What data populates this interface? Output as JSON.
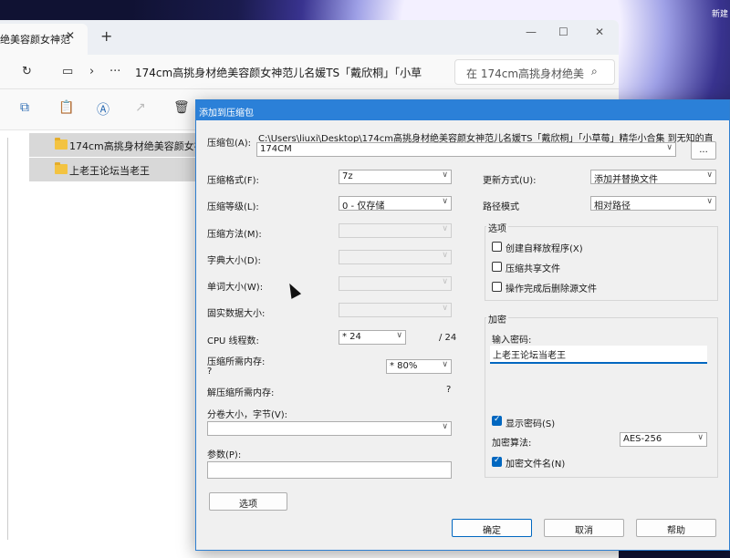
{
  "wallpaper_text": "新建",
  "explorer": {
    "tab_title": "绝美容颜女神范",
    "address_path": "174cm高挑身材绝美容颜女神范儿名媛TS「戴欣桐」「小草",
    "search_placeholder": "在 174cm高挑身材绝美",
    "files": [
      {
        "name": "174cm高挑身材绝美容颜女神范"
      },
      {
        "name": "上老王论坛当老王"
      }
    ]
  },
  "dialog": {
    "title": "添加到压缩包",
    "archive_label": "压缩包(A):",
    "archive_dir": "C:\\Users\\liuxi\\Desktop\\174cm高挑身材绝美容颜女神范儿名媛TS「戴欣桐」「小草莓」精华小合集 到无知的直",
    "archive_name": "174CM",
    "browse_label": "...",
    "format_label": "压缩格式(F):",
    "format_value": "7z",
    "level_label": "压缩等级(L):",
    "level_value": "0 - 仅存储",
    "method_label": "压缩方法(M):",
    "dict_label": "字典大小(D):",
    "word_label": "单词大小(W):",
    "solid_label": "固实数据大小:",
    "cpu_label": "CPU 线程数:",
    "cpu_value": "* 24",
    "cpu_total": "/ 24",
    "mem_label": "压缩所需内存:",
    "mem_q": "?",
    "mem_value": "* 80%",
    "decomp_label": "解压缩所需内存:",
    "decomp_q": "?",
    "split_label": "分卷大小，字节(V):",
    "params_label": "参数(P):",
    "options_button": "选项",
    "update_label": "更新方式(U):",
    "update_value": "添加并替换文件",
    "path_label": "路径模式",
    "path_value": "相对路径",
    "options_group": "选项",
    "opt_sfx": "创建自释放程序(X)",
    "opt_shared": "压缩共享文件",
    "opt_delete": "操作完成后删除源文件",
    "encrypt_group": "加密",
    "pwd_label": "输入密码:",
    "pwd_value": "上老王论坛当老王",
    "show_pwd": "显示密码(S)",
    "algo_label": "加密算法:",
    "algo_value": "AES-256",
    "encrypt_names": "加密文件名(N)",
    "ok": "确定",
    "cancel": "取消",
    "help": "帮助"
  }
}
